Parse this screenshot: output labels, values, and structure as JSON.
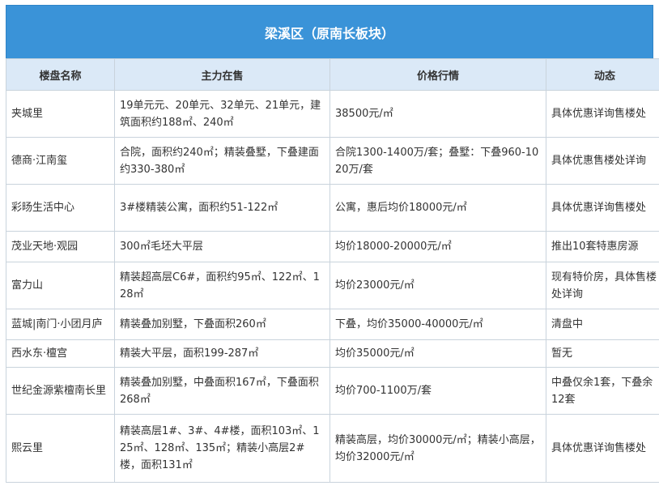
{
  "title": "梁溪区（原南长板块）",
  "columns": [
    "楼盘名称",
    "主力在售",
    "价格行情",
    "动态"
  ],
  "rows": [
    [
      "夹城里",
      "19单元元、20单元、32单元、21单元，建筑面积约188㎡、240㎡",
      "38500元/㎡",
      "具体优惠详询售楼处"
    ],
    [
      "德商·江南玺",
      "合院，面积约240㎡；精装叠墅，下叠建面约330-380㎡",
      "合院1300-1400万/套；叠墅：下叠960-1020万/套",
      "具体优惠售楼处详询"
    ],
    [
      "彩旸生活中心",
      "3#楼精装公寓，面积约51-122㎡",
      "公寓，惠后均价18000元/㎡",
      "具体优惠详询售楼处"
    ],
    [
      "茂业天地·观园",
      "300㎡毛坯大平层",
      "均价18000-20000元/㎡",
      "推出10套特惠房源"
    ],
    [
      "富力山",
      "精装超高层C6#，面积约95㎡、122㎡、128㎡",
      "均价23000元/㎡",
      "现有特价房，具体售楼处详询"
    ],
    [
      "蓝城|南门·小团月庐",
      "精装叠加别墅，下叠面积260㎡",
      "下叠，均价35000-40000元/㎡",
      "清盘中"
    ],
    [
      "西水东·檀宫",
      "精装大平层，面积199-287㎡",
      "均价35000元/㎡",
      "暂无"
    ],
    [
      "世纪金源紫檀南长里",
      "精装叠加别墅，中叠面积167㎡，下叠面积268㎡",
      "均价700-1100万/套",
      "中叠仅余1套，下叠余12套"
    ],
    [
      "熙云里",
      "精装高层1#、3#、4#楼，面积103㎡、125㎡、128㎡、135㎡；精装小高层2#楼，面积131㎡",
      "精装高层，均价30000元/㎡；精装小高层，均价32000元/㎡",
      "具体优惠详询售楼处"
    ]
  ],
  "colors": {
    "title_bg": "#3a93d8",
    "header_bg": "#dbe9f7",
    "border": "#c9d3dc"
  }
}
